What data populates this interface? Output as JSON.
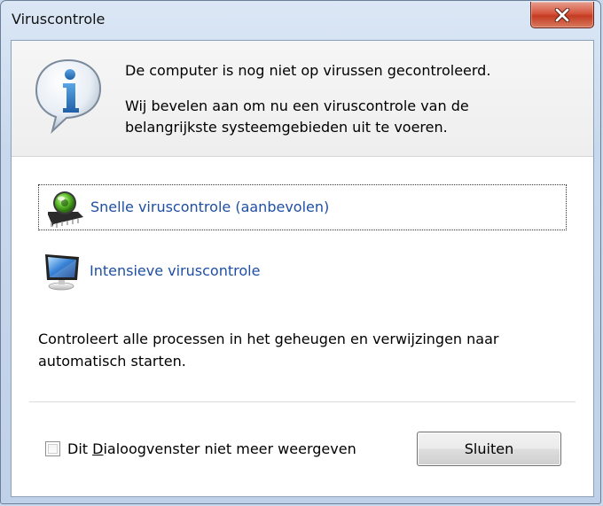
{
  "window": {
    "title": "Viruscontrole"
  },
  "header": {
    "line1": "De computer is nog niet op virussen gecontroleerd.",
    "line2": "Wij bevelen aan om nu een viruscontrole van de belangrijkste systeemgebieden uit te voeren."
  },
  "options": [
    {
      "label": "Snelle viruscontrole (aanbevolen)",
      "icon": "chip-scan-icon",
      "focused": true
    },
    {
      "label": "Intensieve viruscontrole",
      "icon": "monitor-icon",
      "focused": false
    }
  ],
  "description": "Controleert alle processen in het geheugen en verwijzingen naar automatisch starten.",
  "footer": {
    "checkbox_label_pre": "Dit ",
    "checkbox_label_accel": "D",
    "checkbox_label_post": "ialoogvenster niet meer weergeven",
    "checkbox_checked": false,
    "close_label": "Sluiten"
  },
  "colors": {
    "link": "#1f4fa3",
    "close_red": "#c43b21"
  }
}
